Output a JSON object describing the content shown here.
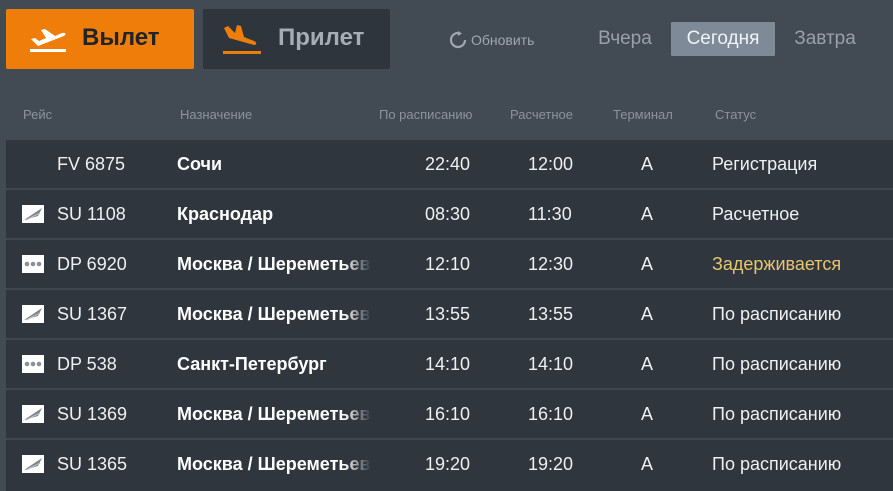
{
  "tabs": {
    "departure_label": "Вылет",
    "arrival_label": "Прилет",
    "departure_icon": "plane-takeoff-icon",
    "arrival_icon": "plane-landing-icon"
  },
  "refresh": {
    "label": "Обновить",
    "icon": "refresh-icon"
  },
  "days": {
    "yesterday": "Вчера",
    "today": "Сегодня",
    "tomorrow": "Завтра"
  },
  "columns": {
    "flight": "Рейс",
    "destination": "Назначение",
    "scheduled": "По расписанию",
    "estimated": "Расчетное",
    "terminal": "Терминал",
    "status": "Статус"
  },
  "colors": {
    "accent": "#ee7d09",
    "delayed": "#e8c56e"
  },
  "flights": [
    {
      "flight": "FV 6875",
      "destination": "Сочи",
      "scheduled": "22:40",
      "estimated": "12:00",
      "terminal": "A",
      "status": "Регистрация",
      "logo": "none"
    },
    {
      "flight": "SU 1108",
      "destination": "Краснодар",
      "scheduled": "08:30",
      "estimated": "11:30",
      "terminal": "A",
      "status": "Расчетное",
      "logo": "aeroflot-logo-icon"
    },
    {
      "flight": "DP 6920",
      "destination": "Москва / Шереметьево",
      "scheduled": "12:10",
      "estimated": "12:30",
      "terminal": "A",
      "status": "Задерживается",
      "logo": "pobeda-logo-icon"
    },
    {
      "flight": "SU 1367",
      "destination": "Москва / Шереметьево",
      "scheduled": "13:55",
      "estimated": "13:55",
      "terminal": "A",
      "status": "По расписанию",
      "logo": "aeroflot-logo-icon"
    },
    {
      "flight": "DP 538",
      "destination": "Санкт-Петербург",
      "scheduled": "14:10",
      "estimated": "14:10",
      "terminal": "A",
      "status": "По расписанию",
      "logo": "pobeda-logo-icon"
    },
    {
      "flight": "SU 1369",
      "destination": "Москва / Шереметьево",
      "scheduled": "16:10",
      "estimated": "16:10",
      "terminal": "A",
      "status": "По расписанию",
      "logo": "aeroflot-logo-icon"
    },
    {
      "flight": "SU 1365",
      "destination": "Москва / Шереметьево",
      "scheduled": "19:20",
      "estimated": "19:20",
      "terminal": "A",
      "status": "По расписанию",
      "logo": "aeroflot-logo-icon"
    }
  ]
}
